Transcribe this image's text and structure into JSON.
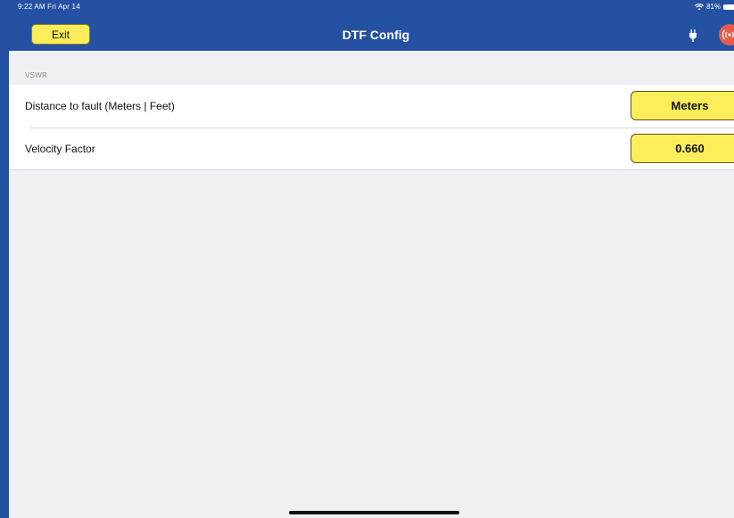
{
  "status_bar": {
    "time": "9:22 AM  Fri Apr 14",
    "battery": "81%",
    "wifi_icon": "wifi-icon",
    "battery_icon": "battery-icon"
  },
  "navbar": {
    "title": "DTF Config",
    "exit_label": "Exit",
    "background_color": "#2451a1",
    "plug_icon": "plug-icon",
    "signal_icon": "signal-broadcast-icon",
    "signal_color": "#e65b4a"
  },
  "section": {
    "header": "VSWR"
  },
  "rows": [
    {
      "label": "Distance to fault (Meters | Feet)",
      "value": "Meters"
    },
    {
      "label": "Velocity Factor",
      "value": "0.660"
    }
  ],
  "colors": {
    "button_yellow": "#fbee5a",
    "background": "#f0eff4"
  }
}
